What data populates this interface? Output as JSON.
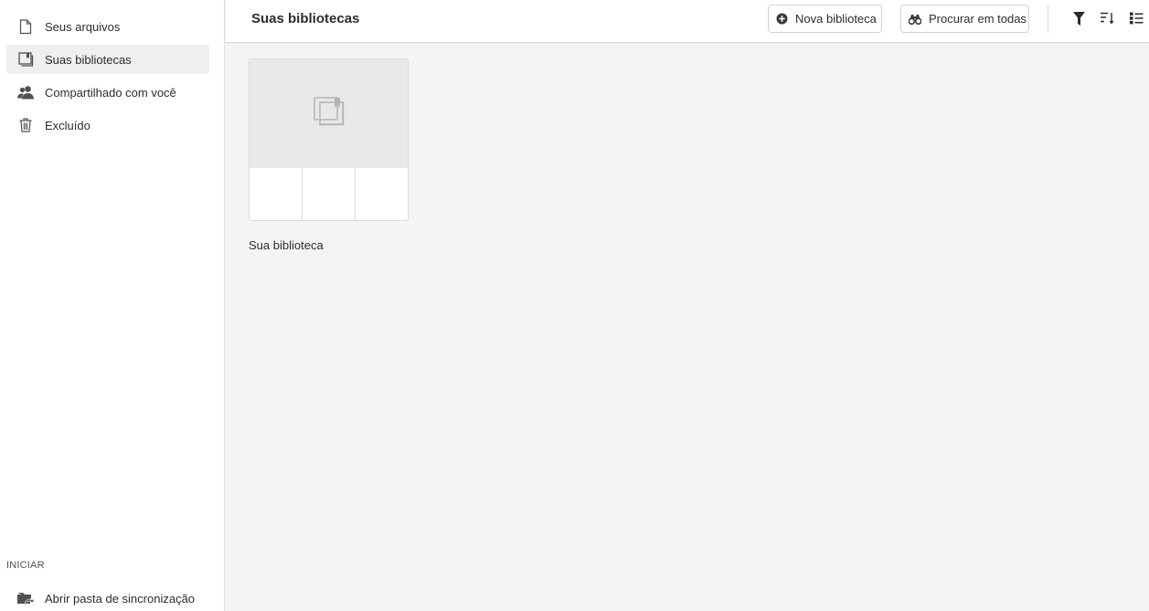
{
  "sidebar": {
    "items": [
      {
        "label": "Seus arquivos",
        "icon": "file-icon",
        "active": false
      },
      {
        "label": "Suas bibliotecas",
        "icon": "library-icon",
        "active": true
      },
      {
        "label": "Compartilhado com você",
        "icon": "people-icon",
        "active": false
      },
      {
        "label": "Excluído",
        "icon": "trash-icon",
        "active": false
      }
    ],
    "section_label": "INICIAR",
    "sync_item": {
      "label": "Abrir pasta de sincronização",
      "icon": "sync-folder-icon"
    }
  },
  "header": {
    "title": "Suas bibliotecas",
    "new_library_label": "Nova biblioteca",
    "search_all_label": "Procurar em todas",
    "tools": [
      "filter-icon",
      "sort-icon",
      "list-view-icon"
    ]
  },
  "libraries": [
    {
      "name": "Sua biblioteca"
    }
  ],
  "colors": {
    "sidebar_bg": "#ffffff",
    "content_bg": "#f4f4f4",
    "active_item_bg": "#efefef",
    "text": "#2c2c2c",
    "icon": "#505050"
  }
}
